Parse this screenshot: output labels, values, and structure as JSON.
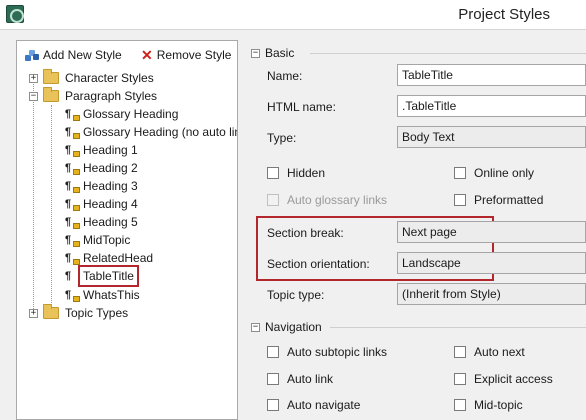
{
  "window": {
    "title": "Project Styles"
  },
  "toolbar": {
    "add_label": "Add New Style",
    "remove_label": "Remove Style"
  },
  "tree": {
    "character_styles": "Character Styles",
    "paragraph_styles": "Paragraph Styles",
    "items": [
      "Glossary Heading",
      "Glossary Heading (no auto lin",
      "Heading 1",
      "Heading 2",
      "Heading 3",
      "Heading 4",
      "Heading 5",
      "MidTopic",
      "RelatedHead",
      "TableTitle",
      "WhatsThis"
    ],
    "selected": "TableTitle",
    "topic_types": "Topic Types"
  },
  "basic": {
    "section_label": "Basic",
    "name_label": "Name:",
    "name_value": "TableTitle",
    "html_name_label": "HTML name:",
    "html_name_value": ".TableTitle",
    "type_label": "Type:",
    "type_value": "Body Text",
    "hidden_label": "Hidden",
    "online_only_label": "Online only",
    "auto_glossary_label": "Auto glossary links",
    "preformatted_label": "Preformatted",
    "section_break_label": "Section break:",
    "section_break_value": "Next page",
    "section_orientation_label": "Section orientation:",
    "section_orientation_value": "Landscape",
    "topic_type_label": "Topic type:",
    "topic_type_value": "(Inherit from Style)"
  },
  "navigation": {
    "section_label": "Navigation",
    "auto_subtopic_label": "Auto subtopic links",
    "auto_next_label": "Auto next",
    "auto_link_label": "Auto link",
    "explicit_access_label": "Explicit access",
    "auto_navigate_label": "Auto navigate",
    "mid_topic_label": "Mid-topic"
  },
  "colors": {
    "highlight": "#b3262b",
    "folder": "#e9c35a",
    "remove": "#d0201b"
  }
}
